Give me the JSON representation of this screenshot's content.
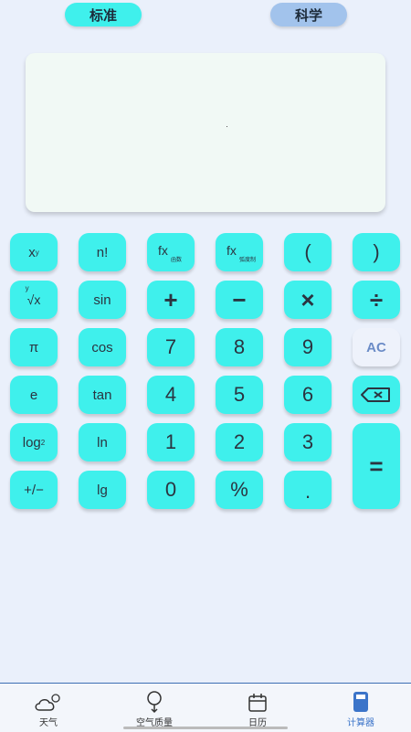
{
  "tabs": {
    "standard": "标准",
    "science": "科学"
  },
  "display": {
    "expression": "",
    "result": ""
  },
  "keys": {
    "pow": "x",
    "pow_sup": "y",
    "fact": "n!",
    "fx": "fx",
    "fx_func": "函数",
    "fx_deg": "弧度制",
    "lparen": "(",
    "rparen": ")",
    "root_y": "y",
    "root_x": "√x",
    "sin": "sin",
    "cos": "cos",
    "tan": "tan",
    "plus": "+",
    "minus": "−",
    "times": "×",
    "divide": "÷",
    "pi": "π",
    "e": "e",
    "n7": "7",
    "n8": "8",
    "n9": "9",
    "n4": "4",
    "n5": "5",
    "n6": "6",
    "n1": "1",
    "n2": "2",
    "n3": "3",
    "n0": "0",
    "ac": "AC",
    "log": "log",
    "log_sub": "2",
    "ln": "ln",
    "lg": "lg",
    "sign": "+/−",
    "percent": "%",
    "dot": ".",
    "equals": "="
  },
  "nav": {
    "weather": "天气",
    "air": "空气质量",
    "calendar": "日历",
    "calculator": "计算器"
  },
  "colors": {
    "key": "#3ff0ec",
    "tab_inactive": "#a2c3ec",
    "accent": "#3b74c9"
  }
}
